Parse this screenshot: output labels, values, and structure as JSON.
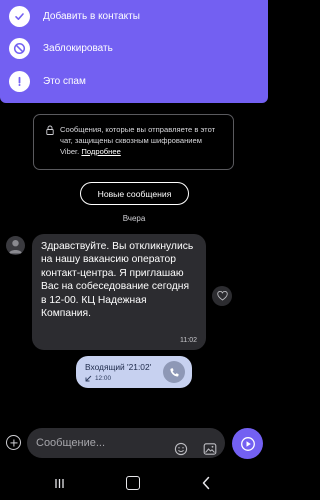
{
  "colors": {
    "accent": "#7360f2",
    "background": "#000000",
    "bubble": "#2c2c30",
    "call_bubble": "#c7d1f0"
  },
  "menu": {
    "items": [
      {
        "label": "Добавить в контакты",
        "icon": "check-icon"
      },
      {
        "label": "Заблокировать",
        "icon": "block-icon"
      },
      {
        "label": "Это спам",
        "icon": "exclamation-icon"
      }
    ]
  },
  "notice": {
    "text": "Сообщения, которые вы отправляете в этот чат, защищены сквозным шифрованием Viber.",
    "link": "Подробнее"
  },
  "new_messages_button": "Новые сообщения",
  "date_separator": "Вчера",
  "message": {
    "text": "Здравствуйте. Вы откликнулись на нашу вакансию оператор контакт-центра. Я приглашаю Вас на собеседование сегодня в 12-00. КЦ Надежная Компания.",
    "time": "11:02"
  },
  "call": {
    "title": "Входящий '21:02'",
    "time": "12:00"
  },
  "composer": {
    "placeholder": "Сообщение..."
  }
}
